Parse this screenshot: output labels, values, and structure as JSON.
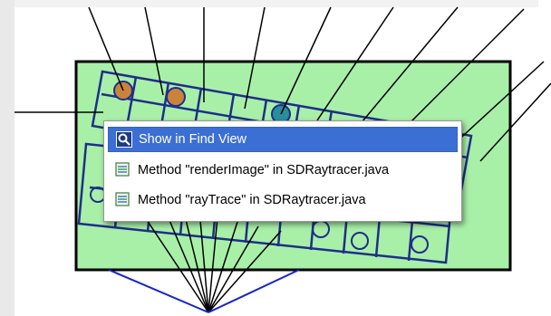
{
  "menu": {
    "items": [
      {
        "label": "Show in Find View",
        "icon": "find-view-icon",
        "selected": true
      },
      {
        "label": "Method \"renderImage\" in SDRaytracer.java",
        "icon": "method-icon",
        "selected": false
      },
      {
        "label": "Method \"rayTrace\" in SDRaytracer.java",
        "icon": "method-icon",
        "selected": false
      }
    ]
  },
  "colors": {
    "selection": "#3c6fd3",
    "package_fill": "#a8f0a8",
    "edge_line": "#1f2e8a",
    "node_orange": "#c9843a",
    "node_teal": "#2a8e9a"
  }
}
